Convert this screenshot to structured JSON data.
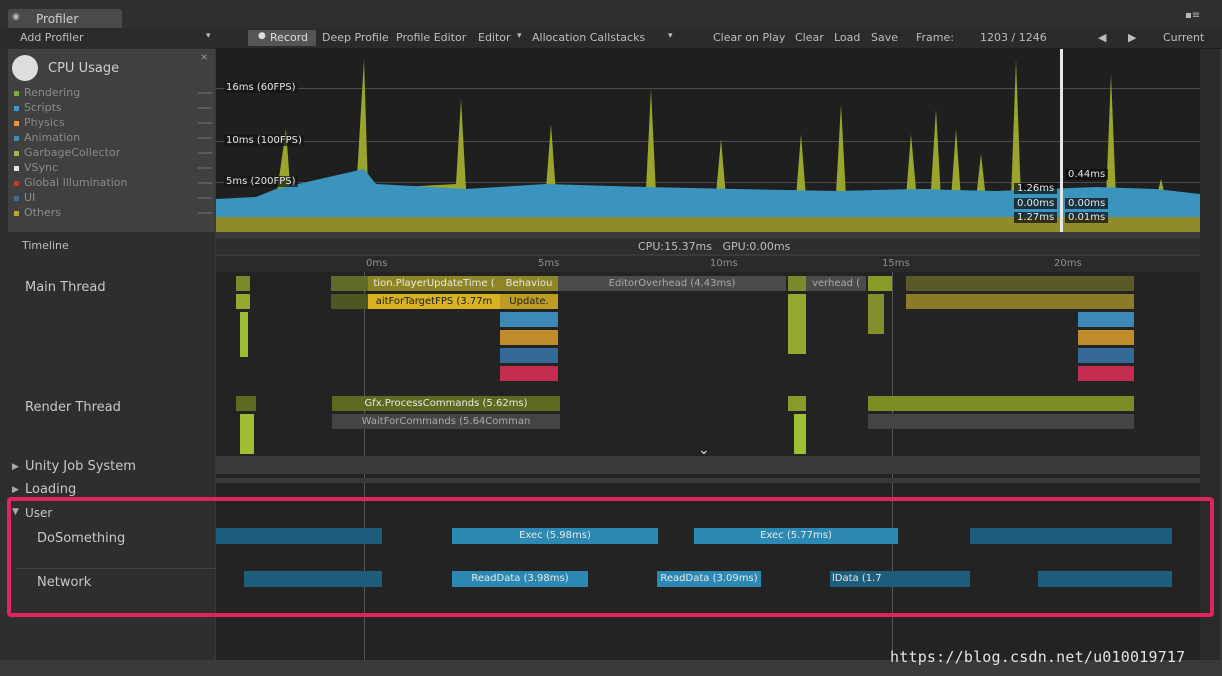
{
  "window": {
    "tab_label": "Profiler",
    "menu_icon": "window-menu-icon"
  },
  "toolbar": {
    "add_profiler": "Add Profiler",
    "record": "Record",
    "deep_profile": "Deep Profile",
    "profile_editor": "Profile Editor",
    "editor": "Editor",
    "allocation_callstacks": "Allocation Callstacks",
    "clear_on_play": "Clear on Play",
    "clear": "Clear",
    "load": "Load",
    "save": "Save",
    "frame_label": "Frame:",
    "frame_value": "1203 / 1246",
    "prev_icon": "prev-frame-icon",
    "next_icon": "next-frame-icon",
    "current": "Current"
  },
  "cpu": {
    "title": "CPU Usage",
    "legend": [
      {
        "label": "Rendering",
        "color": "#7da944"
      },
      {
        "label": "Scripts",
        "color": "#3d9ad1"
      },
      {
        "label": "Physics",
        "color": "#f0943a"
      },
      {
        "label": "Animation",
        "color": "#3e8db5"
      },
      {
        "label": "GarbageCollector",
        "color": "#9db84e"
      },
      {
        "label": "VSync",
        "color": "#e5e5e5"
      },
      {
        "label": "Global Illumination",
        "color": "#c13a30"
      },
      {
        "label": "UI",
        "color": "#3d6f9c"
      },
      {
        "label": "Others",
        "color": "#b9a837"
      }
    ]
  },
  "chart": {
    "line_16": "16ms (60FPS)",
    "line_10": "10ms (100FPS)",
    "line_5": "5ms (200FPS)",
    "values_left": [
      "1.26ms",
      "0.00ms",
      "1.27ms"
    ],
    "values_right": [
      "0.44ms",
      "0.00ms",
      "0.01ms"
    ]
  },
  "status": {
    "timeline_label": "Timeline",
    "cpu_gpu": "CPU:15.37ms   GPU:0.00ms"
  },
  "ruler": [
    "0ms",
    "5ms",
    "10ms",
    "15ms",
    "20ms"
  ],
  "threads": {
    "main": "Main Thread",
    "render": "Render Thread",
    "jobs": "Unity Job System",
    "loading": "Loading",
    "user": "User",
    "do_something": "DoSomething",
    "network": "Network"
  },
  "blocks": {
    "player_update": "tion.PlayerUpdateTime (",
    "behaviour": "Behaviou",
    "editor_overhead": "EditorOverhead (4.43ms)",
    "overhead": "verhead (",
    "wait_fps": "aitForTargetFPS (3.77m",
    "update": "Update.",
    "gfx_process": "Gfx.ProcessCommands (5.62ms)",
    "wait_commands": "WaitForCommands (5.64Comman",
    "exec1": "Exec (5.98ms)",
    "exec2": "Exec (5.77ms)",
    "read1": "ReadData (3.98ms)",
    "read2": "ReadData (3.09ms)",
    "read3": "lData (1.7"
  },
  "watermark": "https://blog.csdn.net/u010019717"
}
